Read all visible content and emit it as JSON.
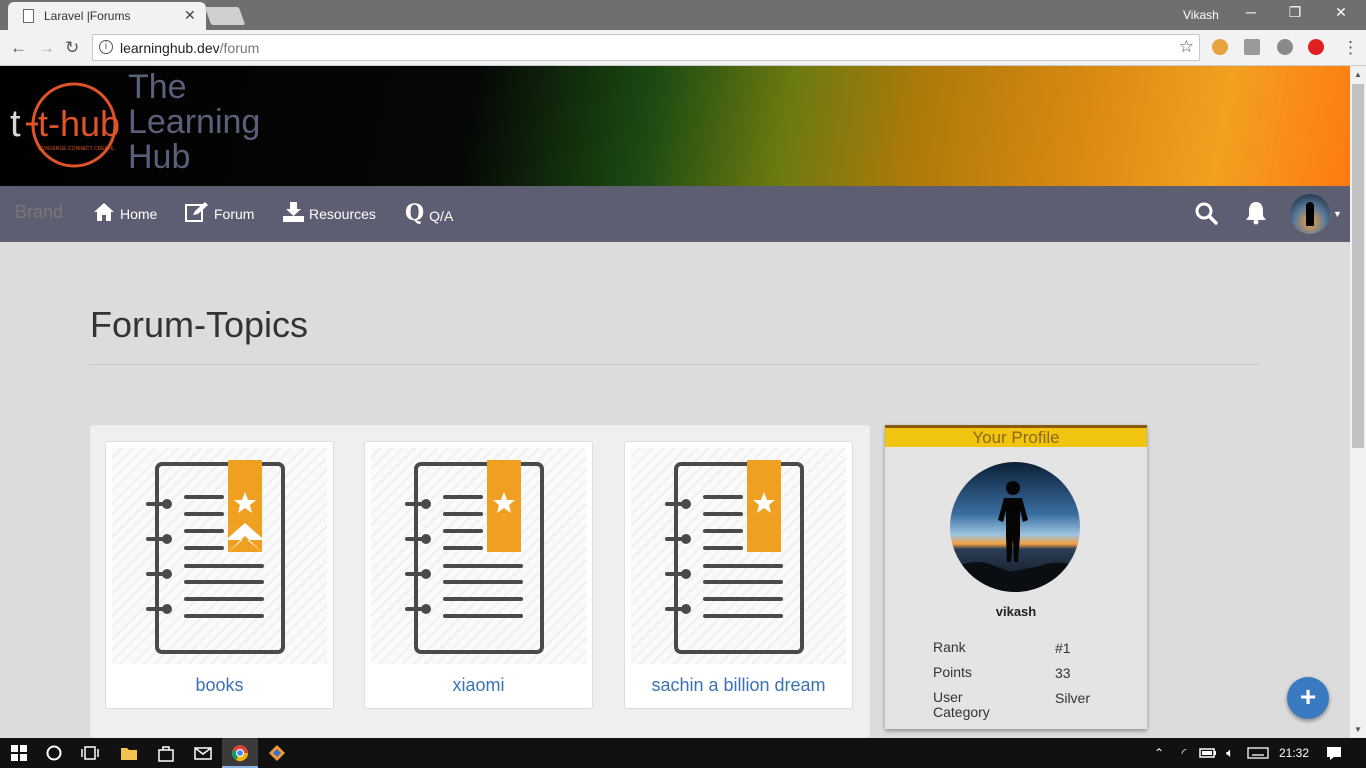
{
  "browser": {
    "tab_title": "Laravel |Forums",
    "tab_close": "✕",
    "window_user": "Vikash",
    "url_host": "learninghub.dev",
    "url_path": "/forum"
  },
  "banner": {
    "logo_text": "t-hub",
    "logo_tagline": "CONVERGE CONNECT CREATE",
    "title_lines": [
      "The",
      "Learning",
      "Hub"
    ]
  },
  "navbar": {
    "brand": "Brand",
    "items": [
      {
        "label": "Home",
        "icon": "home-icon"
      },
      {
        "label": "Forum",
        "icon": "edit-icon"
      },
      {
        "label": "Resources",
        "icon": "download-icon"
      },
      {
        "label": "Q/A",
        "icon": "q-icon"
      }
    ],
    "right_icons": [
      "search-icon",
      "bell-icon",
      "avatar"
    ]
  },
  "page": {
    "title": "Forum-Topics"
  },
  "topics": [
    {
      "label": "books"
    },
    {
      "label": "xiaomi"
    },
    {
      "label": "sachin a billion dream"
    }
  ],
  "profile": {
    "header": "Your Profile",
    "name": "vikash",
    "rows": [
      {
        "label": "Rank",
        "value": "#1"
      },
      {
        "label": "Points",
        "value": "33"
      },
      {
        "label": "User Category",
        "value": "Silver"
      }
    ]
  },
  "fab": {
    "label": "+"
  },
  "taskbar": {
    "clock": "21:32"
  },
  "colors": {
    "navbar": "#5e5e72",
    "link": "#3a73b4",
    "profile_header": "#f1c40f",
    "fab": "#3a7ac0"
  }
}
